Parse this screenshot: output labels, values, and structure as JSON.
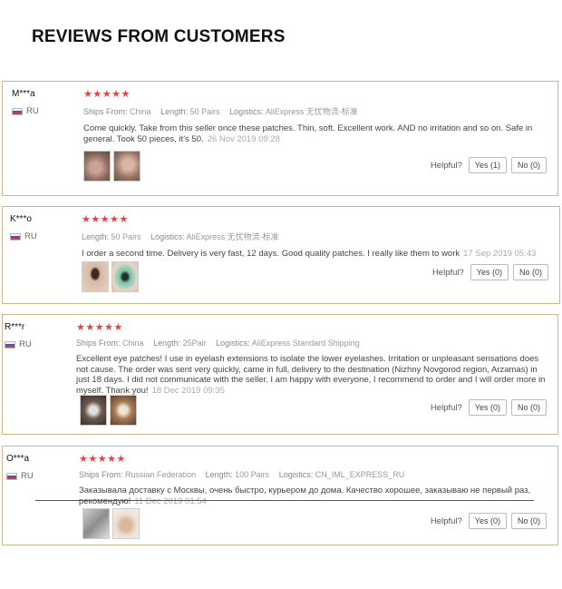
{
  "page": {
    "title": "REVIEWS FROM CUSTOMERS"
  },
  "labels": {
    "ships_from": "Ships From:",
    "length": "Length:",
    "logistics": "Logistics:",
    "helpful": "Helpful?"
  },
  "colors": {
    "star": "#e64340",
    "border": "#cbb98a"
  },
  "reviews": [
    {
      "user": "M***a",
      "country": "RU",
      "stars": "★★★★★",
      "ships_from": "China",
      "length": "50 Pairs",
      "logistics": "AliExpress 无忧物流-标准",
      "text": "Come quickly. Take from this seller once these patches. Thin, soft. Excellent work. AND no irritation and so on. Safe in general. Took 50 pieces, it's 50.",
      "date": "26 Nov 2019 09:28",
      "yes": "Yes (1)",
      "no": "No (0)"
    },
    {
      "user": "K***o",
      "country": "RU",
      "stars": "★★★★★",
      "length": "50 Pairs",
      "logistics": "AliExpress 无忧物流-标准",
      "text": "I order a second time. Delivery is very fast, 12 days. Good quality patches. I really like them to work",
      "date": "17 Sep 2019 05:43",
      "yes": "Yes (0)",
      "no": "No (0)"
    },
    {
      "user": "R***r",
      "country": "RU",
      "stars": "★★★★★",
      "ships_from": "China",
      "length": "25Pair",
      "logistics": "AliExpress Standard Shipping",
      "text": "Excellent eye patches! I use in eyelash extensions to isolate the lower eyelashes. Irritation or unpleasant sensations does not cause. The order was sent very quickly, came in full, delivery to the destination (Nizhny Novgorod region, Arzamas) in just 18 days. I did not communicate with the seller. I am happy with everyone, I recommend to order and I will order more in myself. Thank you!",
      "date": "18 Dec 2019 09:35",
      "yes": "Yes (0)",
      "no": "No (0)"
    },
    {
      "user": "O***a",
      "country": "RU",
      "stars": "★★★★★",
      "ships_from": "Russian Federation",
      "length": "100 Pairs",
      "logistics": "CN_IML_EXPRESS_RU",
      "text": "Заказывала доставку с Москвы, очень быстро, курьером до дома. Качество хорошее, заказываю не первый раз, рекомендую!",
      "date": "11 Dec 2019 01:54",
      "yes": "Yes (0)",
      "no": "No (0)"
    }
  ]
}
